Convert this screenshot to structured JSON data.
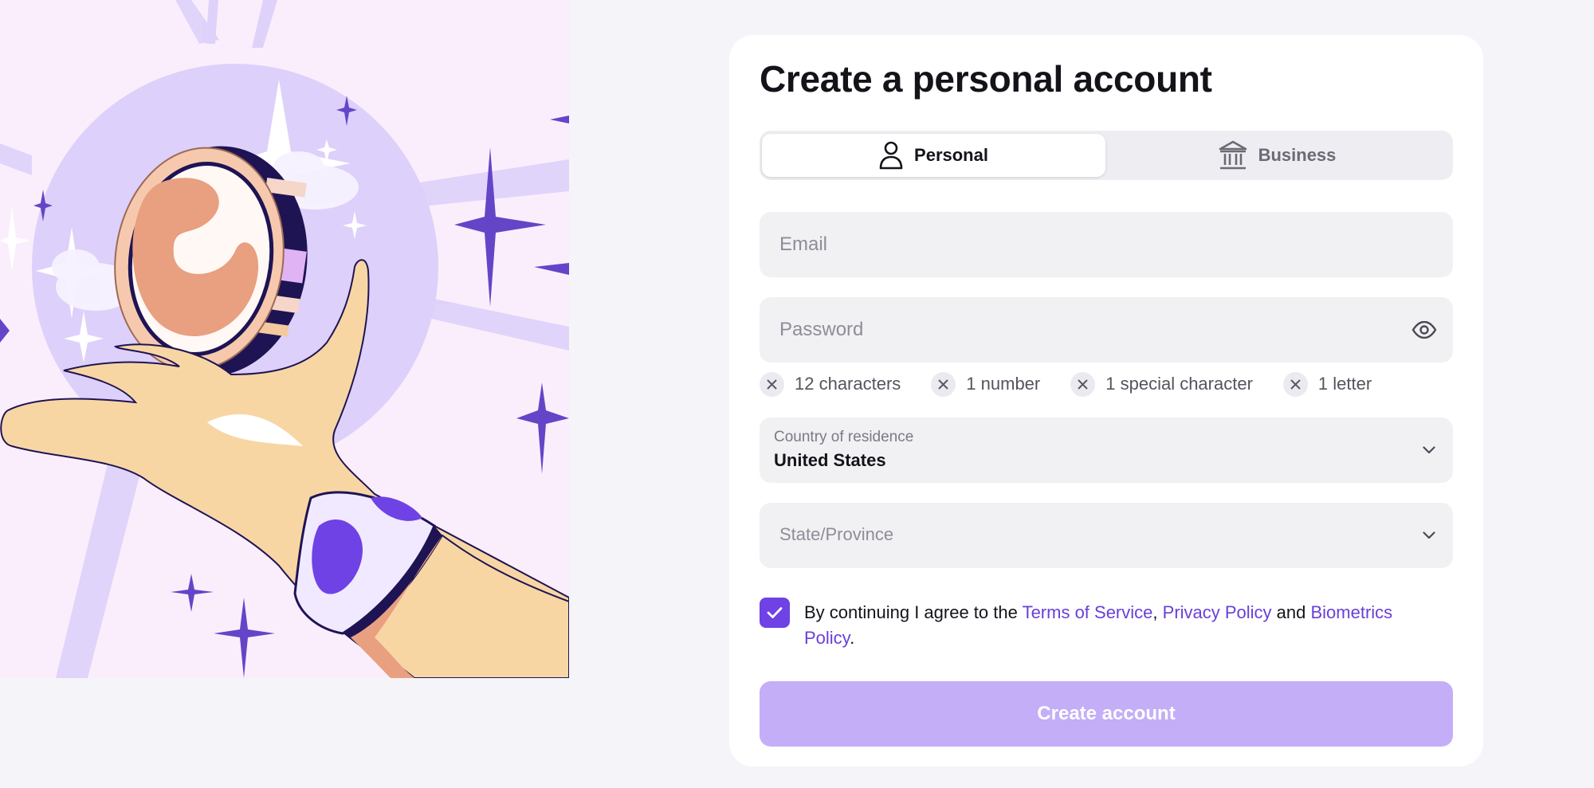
{
  "form": {
    "title": "Create a personal account",
    "tabs": [
      {
        "label": "Personal",
        "icon": "person-icon",
        "selected": true
      },
      {
        "label": "Business",
        "icon": "bank-icon",
        "selected": false
      }
    ],
    "email": {
      "placeholder": "Email",
      "value": ""
    },
    "password": {
      "placeholder": "Password",
      "value": ""
    },
    "requirements": [
      {
        "label": "12 characters",
        "met": false
      },
      {
        "label": "1 number",
        "met": false
      },
      {
        "label": "1 special character",
        "met": false
      },
      {
        "label": "1 letter",
        "met": false
      }
    ],
    "country": {
      "label": "Country of residence",
      "value": "United States"
    },
    "state": {
      "placeholder": "State/Province"
    },
    "consent": {
      "checked": true,
      "prefix": "By continuing I agree to the ",
      "terms_link": "Terms of Service",
      "comma": ",",
      "privacy_link": "Privacy Policy",
      "and": " and ",
      "biometrics_link": "Biometrics Policy",
      "suffix": "."
    },
    "submit_label": "Create account"
  },
  "colors": {
    "accent": "#6e42e5",
    "link": "#6a3fd9",
    "button_disabled": "#c3aef7",
    "field_bg": "#f1f1f4",
    "illustration_bg": "#fbeefc",
    "illustration_circle": "#ddd0fa"
  }
}
